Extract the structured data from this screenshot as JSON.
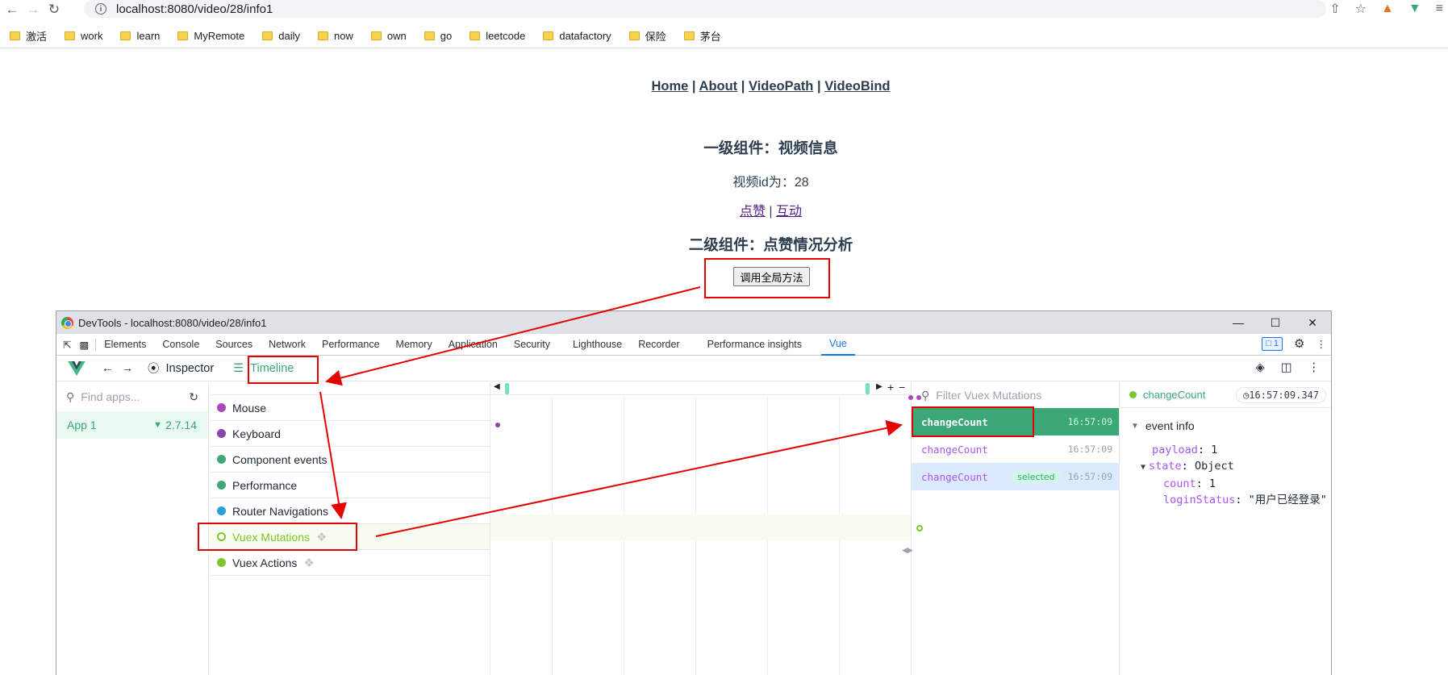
{
  "browser": {
    "url": "localhost:8080/video/28/info1",
    "bookmarks": [
      "激活",
      "work",
      "learn",
      "MyRemote",
      "daily",
      "now",
      "own",
      "go",
      "leetcode",
      "datafactory",
      "保险",
      "茅台"
    ]
  },
  "page": {
    "nav": {
      "home": "Home",
      "about": "About",
      "videopath": "VideoPath",
      "videobind": "VideoBind",
      "sep": "|"
    },
    "h1": "一级组件：视频信息",
    "video_id_text": "视频id为：28",
    "link_like": "点赞",
    "link_interact": "互动",
    "h2": "二级组件：点赞情况分析",
    "call_button": "调用全局方法"
  },
  "devtools": {
    "window_title": "DevTools - localhost:8080/video/28/info1",
    "tabs": [
      "Elements",
      "Console",
      "Sources",
      "Network",
      "Performance",
      "Memory",
      "Application",
      "Security",
      "Lighthouse",
      "Recorder",
      "Performance insights",
      "Vue"
    ],
    "issues_count": "1",
    "vue": {
      "inspector": "Inspector",
      "timeline": "Timeline",
      "find_apps_placeholder": "Find apps...",
      "app_name": "App 1",
      "vue_version": "2.7.14",
      "layers": [
        {
          "label": "Mouse",
          "color": "#ab47bc"
        },
        {
          "label": "Keyboard",
          "color": "#8e44ad"
        },
        {
          "label": "Component events",
          "color": "#3ba776"
        },
        {
          "label": "Performance",
          "color": "#3ba776"
        },
        {
          "label": "Router Navigations",
          "color": "#2ba0d6"
        },
        {
          "label": "Vuex Mutations",
          "color": "#7cc72e"
        },
        {
          "label": "Vuex Actions",
          "color": "#7cc72e"
        }
      ],
      "filter_placeholder": "Filter Vuex Mutations",
      "mutations": [
        {
          "name": "changeCount",
          "time": "16:57:09",
          "state": "active"
        },
        {
          "name": "changeCount",
          "time": "16:57:09",
          "state": "normal"
        },
        {
          "name": "changeCount",
          "time": "16:57:09",
          "state": "selected",
          "tag": "selected"
        }
      ],
      "detail": {
        "event_name": "changeCount",
        "timestamp": "16:57:09.347",
        "section": "event info",
        "payload_key": "payload",
        "payload_val": "1",
        "state_key": "state",
        "state_val": "Object",
        "count_key": "count",
        "count_val": "1",
        "login_key": "loginStatus",
        "login_val": "\"用户已经登录\""
      }
    }
  },
  "colors": {
    "vue_green": "#3ba776",
    "annotation_red": "#e60000"
  }
}
